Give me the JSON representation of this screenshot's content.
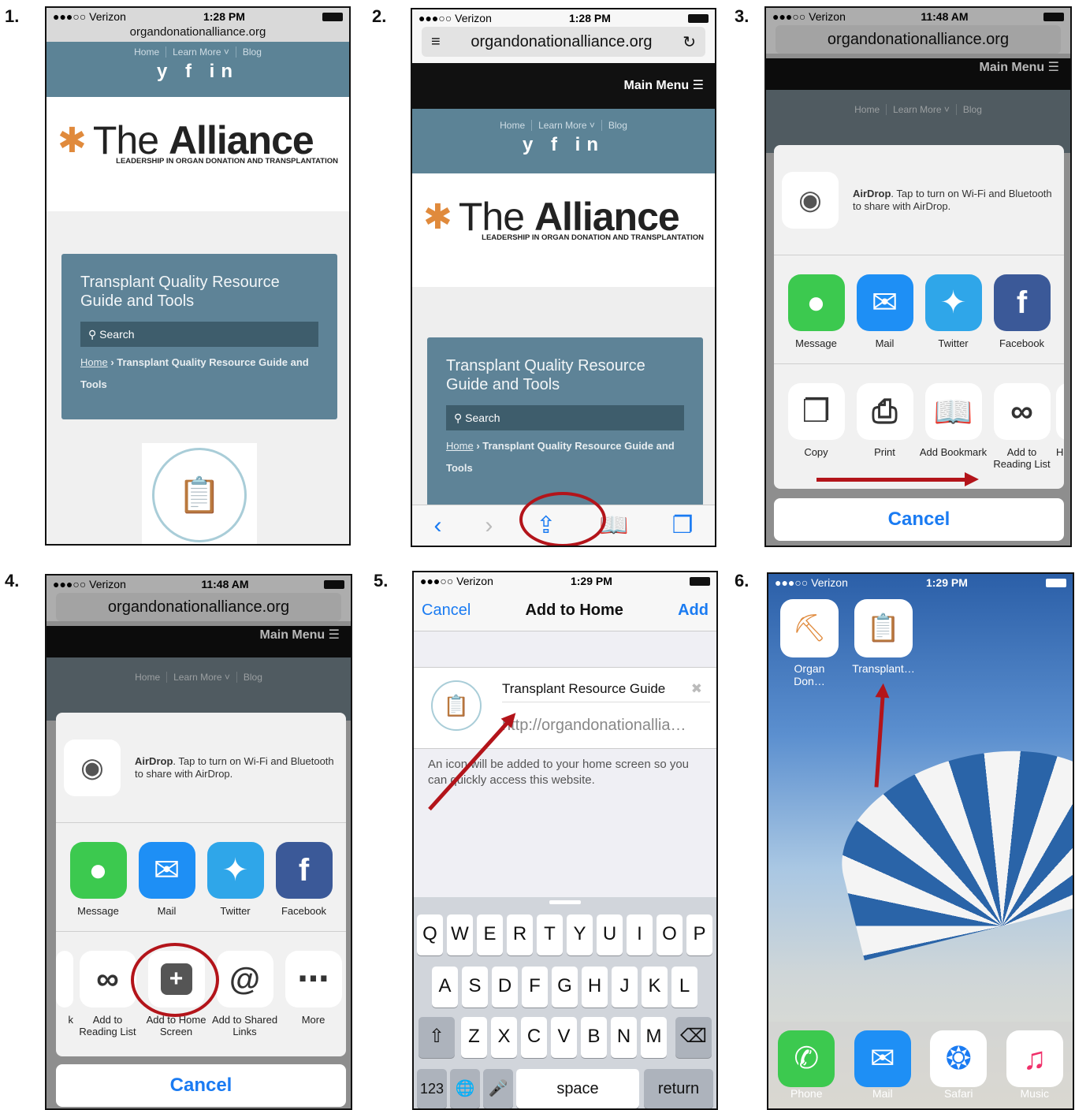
{
  "steps": [
    "1.",
    "2.",
    "3.",
    "4.",
    "5.",
    "6."
  ],
  "status": {
    "carrier": "●●●○○ Verizon",
    "time_1": "1:28 PM",
    "time_2": "1:28 PM",
    "time_3": "11:48 AM",
    "time_4": "11:48 AM",
    "time_5": "1:29 PM",
    "time_6": "1:29 PM"
  },
  "browser": {
    "url": "organdonationalliance.org",
    "main_menu": "Main Menu"
  },
  "site": {
    "nav_links": [
      "Home",
      "Learn More ˅",
      "Blog"
    ],
    "social": "y f in",
    "logo_text_light": "The ",
    "logo_text_bold": "Alliance",
    "tagline": "LEADERSHIP IN ORGAN DONATION AND TRANSPLANTATION",
    "card_title": "Transplant Quality Resource Guide and Tools",
    "search": "Search",
    "breadcrumb_home": "Home",
    "breadcrumb_rest": "› Transplant Quality Resource Guide and Tools"
  },
  "share": {
    "airdrop_bold": "AirDrop",
    "airdrop_text": ". Tap to turn on Wi-Fi and Bluetooth to share with AirDrop.",
    "apps": [
      "Message",
      "Mail",
      "Twitter",
      "Facebook"
    ],
    "actions_3": [
      "Copy",
      "Print",
      "Add Bookmark",
      "Add to Reading List",
      "Ho"
    ],
    "actions_4": [
      "k",
      "Add to Reading List",
      "Add to Home Screen",
      "Add to Shared Links",
      "More"
    ],
    "cancel": "Cancel"
  },
  "add_home": {
    "cancel": "Cancel",
    "title": "Add to Home",
    "add": "Add",
    "name": "Transplant Resource Guide",
    "url": "http://organdonationallia…",
    "note": "An icon will be added to your home screen so you can quickly access this website."
  },
  "keyboard": {
    "row1": [
      "Q",
      "W",
      "E",
      "R",
      "T",
      "Y",
      "U",
      "I",
      "O",
      "P"
    ],
    "row2": [
      "A",
      "S",
      "D",
      "F",
      "G",
      "H",
      "J",
      "K",
      "L"
    ],
    "row3": [
      "Z",
      "X",
      "C",
      "V",
      "B",
      "N",
      "M"
    ],
    "num": "123",
    "space": "space",
    "return": "return"
  },
  "home": {
    "icons": [
      "Organ Don…",
      "Transplant…"
    ],
    "dock": [
      "Phone",
      "Mail",
      "Safari",
      "Music"
    ]
  },
  "colors": {
    "annotation": "#b3141a",
    "site_blue": "#5e8397",
    "ios_blue": "#1a7bf2"
  }
}
